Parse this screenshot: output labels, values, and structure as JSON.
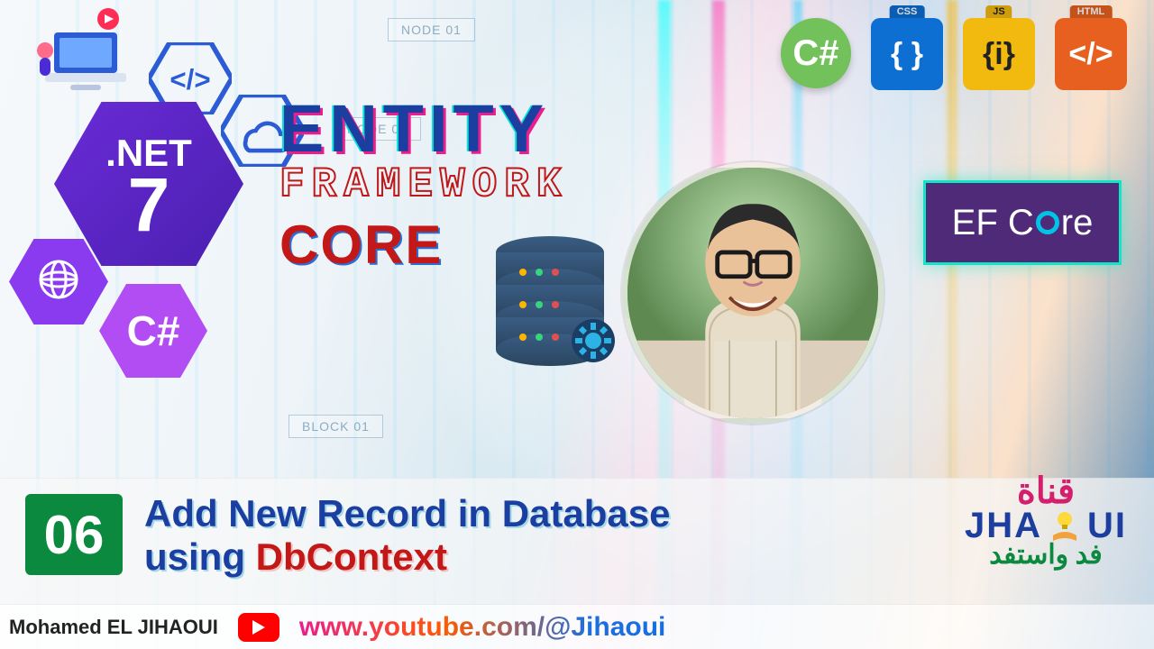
{
  "bg_blocks": {
    "node01": "NODE 01",
    "node04": "NODE 04",
    "block01": "BLOCK 01"
  },
  "hex": {
    "net7_line1": ".NET",
    "net7_line2": "7",
    "csharp_glyph": "C#"
  },
  "headline": {
    "entity": "ENTITY",
    "framework": "FRAMEWORK",
    "core": "CORE"
  },
  "badges": {
    "csharp": {
      "label": "C#"
    },
    "css": {
      "tab": "CSS",
      "glyph": "{ }"
    },
    "js": {
      "tab": "JS",
      "glyph": "{i}"
    },
    "html": {
      "tab": "HTML",
      "glyph": "</>"
    }
  },
  "efcore": {
    "prefix": "EF C",
    "suffix": "re"
  },
  "episode": {
    "number": "06"
  },
  "lesson": {
    "line1": "Add New Record in Database",
    "line2_prefix": "using ",
    "line2_highlight": "DbContext"
  },
  "channel": {
    "ar_top": "قناة",
    "latin_left": "JHA",
    "latin_right": "UI",
    "ar_bottom": "فد واستفد"
  },
  "footer": {
    "author": "Mohamed EL JIHAOUI",
    "url": "www.youtube.com/@Jihaoui"
  }
}
